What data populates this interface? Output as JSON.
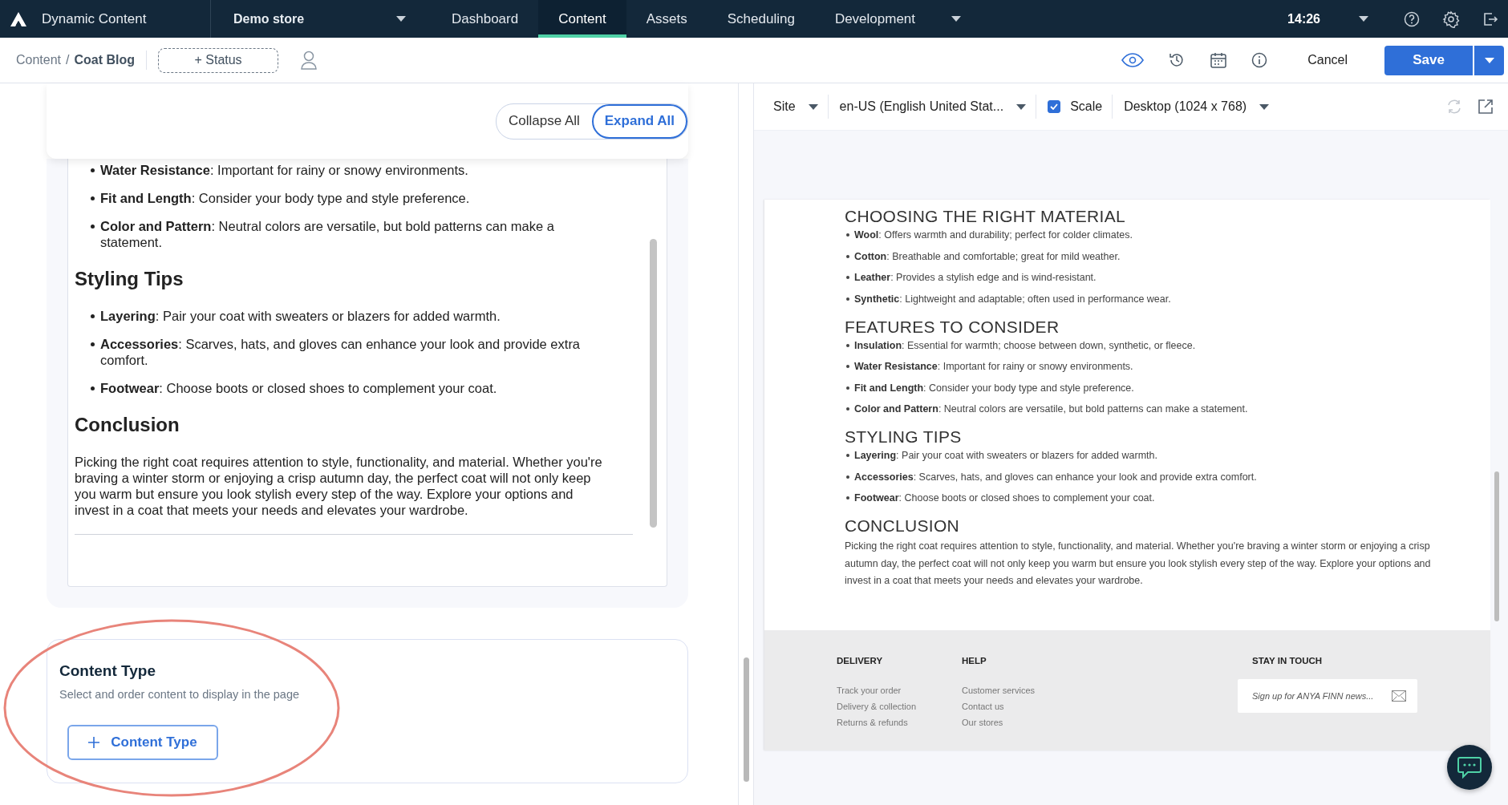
{
  "app": {
    "name": "Dynamic Content"
  },
  "hub": {
    "label": "Demo store"
  },
  "nav_tabs": [
    {
      "label": "Dashboard",
      "selected": false
    },
    {
      "label": "Content",
      "selected": true
    },
    {
      "label": "Assets",
      "selected": false
    },
    {
      "label": "Scheduling",
      "selected": false
    },
    {
      "label": "Development",
      "selected": false
    }
  ],
  "clock": "14:26",
  "breadcrumb": {
    "items": [
      "Content",
      "Coat Blog"
    ],
    "separator": "/"
  },
  "status_button": "+ Status",
  "actions": {
    "cancel": "Cancel",
    "save": "Save"
  },
  "editor": {
    "toggle": [
      {
        "label": "Collapse All",
        "selected": false
      },
      {
        "label": "Expand All",
        "selected": true
      }
    ],
    "blocks": [
      {
        "kind": "list",
        "items": [
          "**Water Resistance**: Important for rainy or snowy environments.",
          "**Fit and Length**: Consider your body type and style preference.",
          "**Color and Pattern**: Neutral colors are versatile, but bold patterns can make a statement."
        ]
      },
      {
        "kind": "heading",
        "text": "Styling Tips"
      },
      {
        "kind": "list",
        "items": [
          "**Layering**: Pair your coat with sweaters or blazers for added warmth.",
          "**Accessories**: Scarves, hats, and gloves can enhance your look and provide extra comfort.",
          "**Footwear**: Choose boots or closed shoes to complement your coat."
        ]
      },
      {
        "kind": "heading",
        "text": "Conclusion"
      },
      {
        "kind": "paragraph",
        "text": "Picking the right coat requires attention to style, functionality, and material. Whether you're braving a winter storm or enjoying a crisp autumn day, the perfect coat will not only keep you warm but ensure you look stylish every step of the way. Explore your options and invest in a coat that meets your needs and elevates your wardrobe."
      }
    ]
  },
  "content_type": {
    "title": "Content Type",
    "subtitle": "Select and order content to display in the page",
    "button": "Content Type"
  },
  "preview": {
    "toolbar": {
      "site": "Site",
      "locale": "en-US (English United Stat...",
      "scale": {
        "label": "Scale",
        "checked": true
      },
      "device": "Desktop (1024 x 768)"
    },
    "blocks": [
      {
        "kind": "heading",
        "text": "CHOOSING THE RIGHT MATERIAL"
      },
      {
        "kind": "list",
        "items": [
          "**Wool**: Offers warmth and durability; perfect for colder climates.",
          "**Cotton**: Breathable and comfortable; great for mild weather.",
          "**Leather**: Provides a stylish edge and is wind-resistant.",
          "**Synthetic**: Lightweight and adaptable; often used in performance wear."
        ]
      },
      {
        "kind": "heading",
        "text": "FEATURES TO CONSIDER"
      },
      {
        "kind": "list",
        "items": [
          "**Insulation**: Essential for warmth; choose between down, synthetic, or fleece.",
          "**Water Resistance**: Important for rainy or snowy environments.",
          "**Fit and Length**: Consider your body type and style preference.",
          "**Color and Pattern**: Neutral colors are versatile, but bold patterns can make a statement."
        ]
      },
      {
        "kind": "heading",
        "text": "STYLING TIPS"
      },
      {
        "kind": "list",
        "items": [
          "**Layering**: Pair your coat with sweaters or blazers for added warmth.",
          "**Accessories**: Scarves, hats, and gloves can enhance your look and provide extra comfort.",
          "**Footwear**: Choose boots or closed shoes to complement your coat."
        ]
      },
      {
        "kind": "heading",
        "text": "CONCLUSION"
      },
      {
        "kind": "paragraph",
        "text": "Picking the right coat requires attention to style, functionality, and material. Whether you're braving a winter storm or enjoying a crisp autumn day, the perfect coat will not only keep you warm but ensure you look stylish every step of the way. Explore your options and invest in a coat that meets your needs and elevates your wardrobe."
      }
    ],
    "footer": {
      "columns": [
        {
          "heading": "DELIVERY",
          "links": [
            "Track your order",
            "Delivery & collection",
            "Returns & refunds"
          ]
        },
        {
          "heading": "HELP",
          "links": [
            "Customer services",
            "Contact us",
            "Our stores"
          ]
        }
      ],
      "newsletter": {
        "heading": "STAY IN TOUCH",
        "placeholder": "Sign up for ANYA FINN news..."
      }
    }
  }
}
